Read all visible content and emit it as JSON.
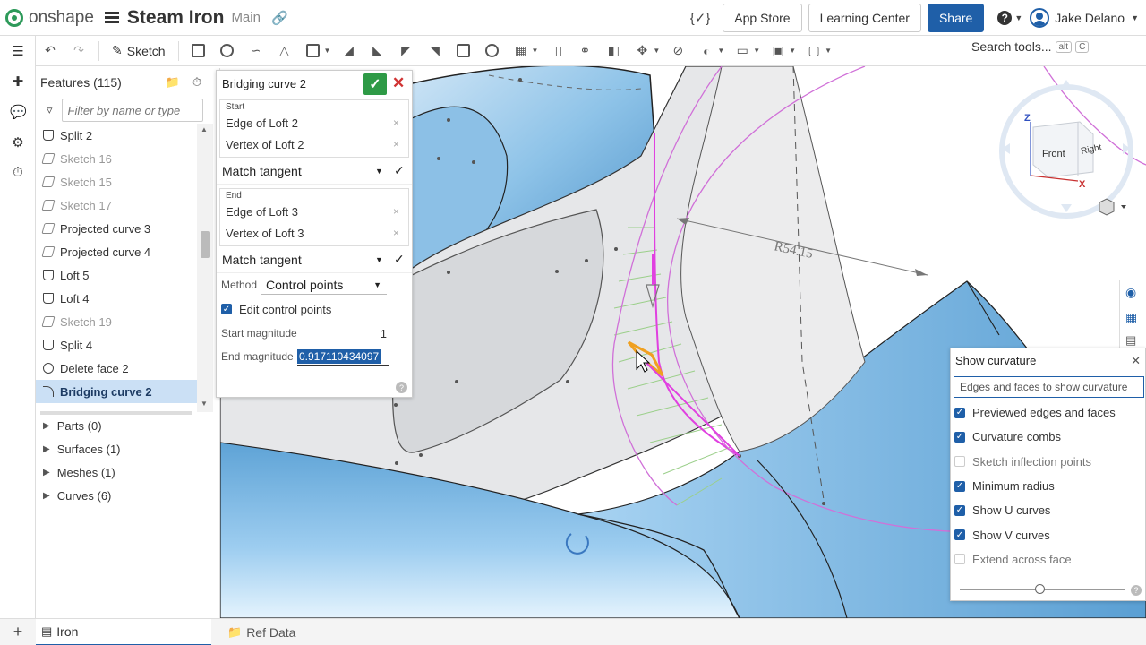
{
  "app": {
    "logo_text": "onshape",
    "document_title": "Steam Iron",
    "branch": "Main"
  },
  "topbar": {
    "app_store": "App Store",
    "learning_center": "Learning Center",
    "share": "Share",
    "user_name": "Jake Delano"
  },
  "toolbar": {
    "sketch_label": "Sketch",
    "search_label": "Search tools...",
    "shortcut_alt": "alt",
    "shortcut_key": "C"
  },
  "feature_tree": {
    "title": "Features (115)",
    "filter_placeholder": "Filter by name or type",
    "items": [
      {
        "label": "Split 2",
        "kind": "solid",
        "dim": false
      },
      {
        "label": "Sketch 16",
        "kind": "sketch",
        "dim": true
      },
      {
        "label": "Sketch 15",
        "kind": "sketch",
        "dim": true
      },
      {
        "label": "Sketch 17",
        "kind": "sketch",
        "dim": true
      },
      {
        "label": "Projected curve 3",
        "kind": "sketch",
        "dim": false
      },
      {
        "label": "Projected curve 4",
        "kind": "sketch",
        "dim": false
      },
      {
        "label": "Loft 5",
        "kind": "solid",
        "dim": false
      },
      {
        "label": "Loft 4",
        "kind": "solid",
        "dim": false
      },
      {
        "label": "Sketch 19",
        "kind": "sketch",
        "dim": true
      },
      {
        "label": "Split 4",
        "kind": "solid",
        "dim": false
      },
      {
        "label": "Delete face 2",
        "kind": "delete",
        "dim": false
      },
      {
        "label": "Bridging curve 2",
        "kind": "curve",
        "dim": false
      }
    ],
    "groups": [
      {
        "label": "Parts (0)"
      },
      {
        "label": "Surfaces (1)"
      },
      {
        "label": "Meshes (1)"
      },
      {
        "label": "Curves (6)"
      }
    ]
  },
  "dialog": {
    "title": "Bridging curve 2",
    "start_label": "Start",
    "start_items": [
      "Edge of Loft 2",
      "Vertex of Loft 2"
    ],
    "start_match": "Match tangent",
    "end_label": "End",
    "end_items": [
      "Edge of Loft 3",
      "Vertex of Loft 3"
    ],
    "end_match": "Match tangent",
    "method_label": "Method",
    "method_value": "Control points",
    "edit_control_points": "Edit control points",
    "start_magnitude_label": "Start magnitude",
    "start_magnitude_value": "1",
    "end_magnitude_label": "End magnitude",
    "end_magnitude_value": "0.917110434097"
  },
  "viewport": {
    "dimension_label": "R54.15",
    "cube_front": "Front",
    "cube_right": "Right",
    "axis_x": "X",
    "axis_z": "Z"
  },
  "curvature": {
    "title": "Show curvature",
    "input_placeholder": "Edges and faces to show curvature",
    "options": [
      {
        "label": "Previewed edges and faces",
        "checked": true
      },
      {
        "label": "Curvature combs",
        "checked": true
      },
      {
        "label": "Sketch inflection points",
        "checked": false
      },
      {
        "label": "Minimum radius",
        "checked": true
      },
      {
        "label": "Show U curves",
        "checked": true
      },
      {
        "label": "Show V curves",
        "checked": true
      },
      {
        "label": "Extend across face",
        "checked": false
      }
    ]
  },
  "tabs": [
    {
      "label": "Iron",
      "active": true
    },
    {
      "label": "Ref Data",
      "active": false
    }
  ],
  "colors": {
    "accent": "#1f5fa8",
    "ok": "#2e9a46",
    "cancel": "#d03333",
    "surface_blue": "#8ec3e8",
    "curve_magenta": "#e040e0",
    "selection_orange": "#f0a020"
  }
}
